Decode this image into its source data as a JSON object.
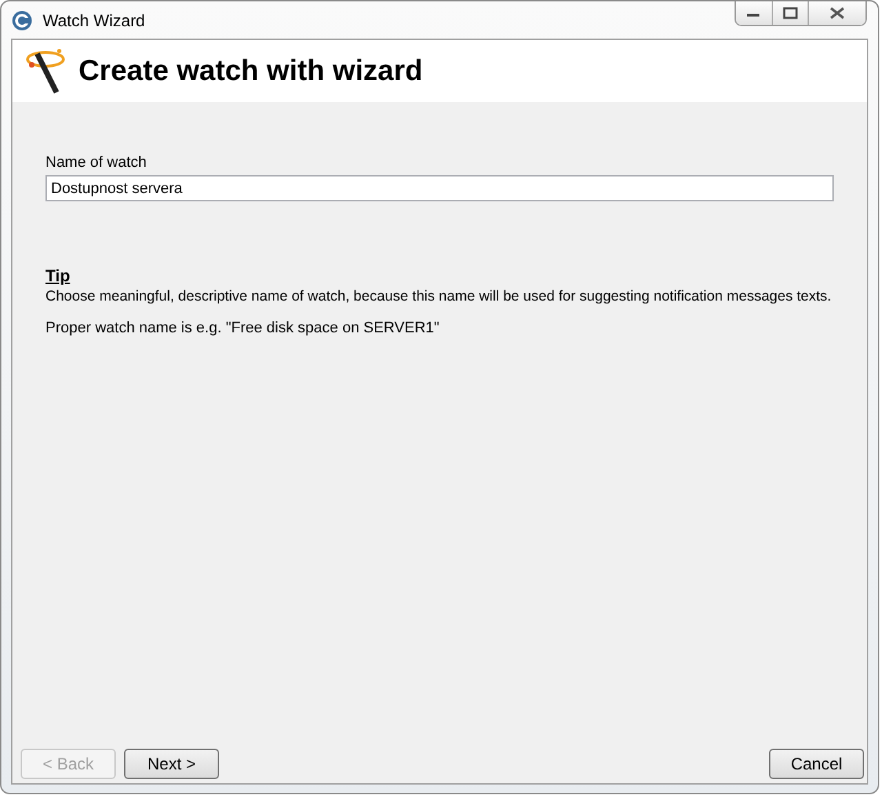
{
  "window": {
    "title": "Watch Wizard"
  },
  "header": {
    "title": "Create watch with wizard"
  },
  "name_field": {
    "label": "Name of watch",
    "value": "Dostupnost servera"
  },
  "tip": {
    "heading": "Tip",
    "text": "Choose meaningful, descriptive name of watch, because this name will be used for suggesting notification messages texts.",
    "example": "Proper watch name is e.g. \"Free disk space on SERVER1\""
  },
  "buttons": [
    {
      "label": "< Back",
      "disabled": true,
      "kind": "nav"
    },
    {
      "label": "Next >",
      "disabled": false,
      "kind": "nav"
    },
    {
      "label": "Cancel",
      "disabled": false,
      "kind": "cancel"
    }
  ]
}
